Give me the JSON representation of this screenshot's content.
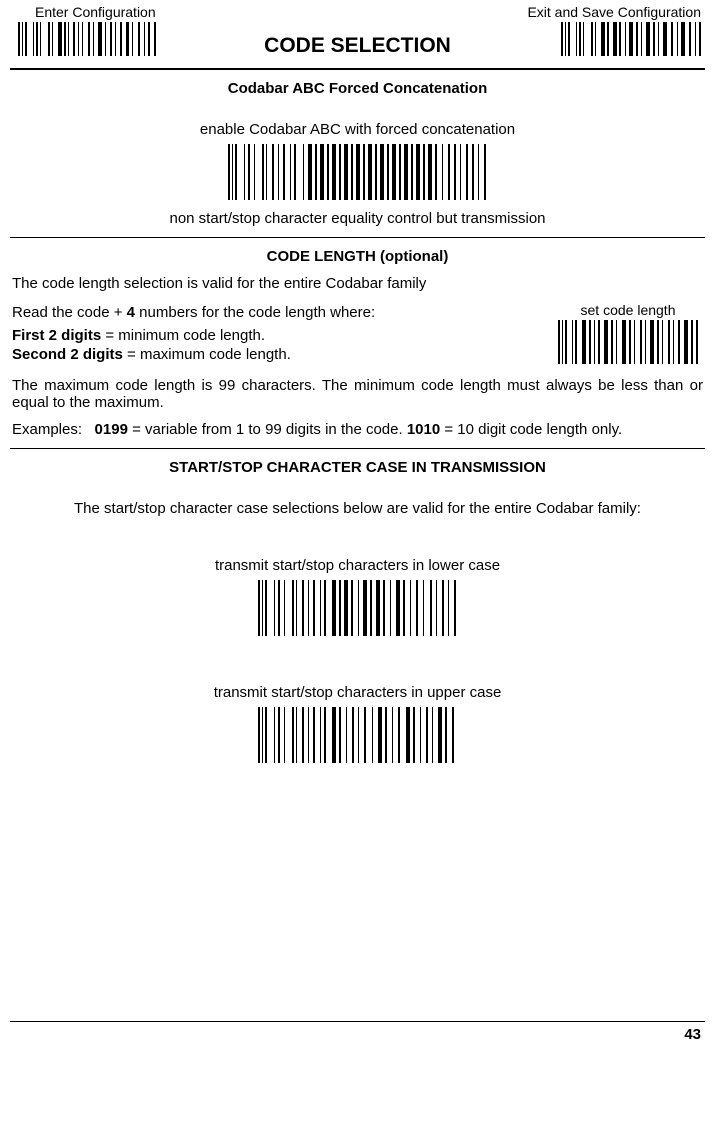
{
  "header": {
    "enter_label": "Enter Configuration",
    "exit_label": "Exit and Save Configuration",
    "title": "CODE SELECTION"
  },
  "section1": {
    "title": "Codabar ABC Forced Concatenation",
    "caption_top": "enable Codabar ABC with forced concatenation",
    "caption_bottom": "non start/stop character equality control but transmission"
  },
  "section2": {
    "title": "CODE LENGTH (optional)",
    "intro": "The code length selection is valid for the entire Codabar family",
    "read_line_prefix": "Read the code + ",
    "read_line_bold": "4",
    "read_line_suffix": " numbers for the code length where:",
    "first_line_bold": "First 2 digits",
    "first_line_rest": " = minimum code length.",
    "second_line_bold": "Second 2 digits",
    "second_line_rest": " = maximum code length.",
    "side_label": "set code length",
    "max_note": "The maximum code length is 99 characters. The minimum code length must always be less than or equal to the maximum.",
    "examples_label": "Examples:",
    "ex1_bold": "0199",
    "ex1_rest": " = variable from 1 to 99 digits in the code.  ",
    "ex2_bold": "1010",
    "ex2_rest": " = 10 digit code length only."
  },
  "section3": {
    "title": "START/STOP CHARACTER CASE IN TRANSMISSION",
    "intro": "The start/stop character case selections below are valid for the entire Codabar family:",
    "lower_caption": "transmit start/stop characters in lower case",
    "upper_caption": "transmit start/stop characters in upper case"
  },
  "footer": {
    "page_number": "43"
  }
}
